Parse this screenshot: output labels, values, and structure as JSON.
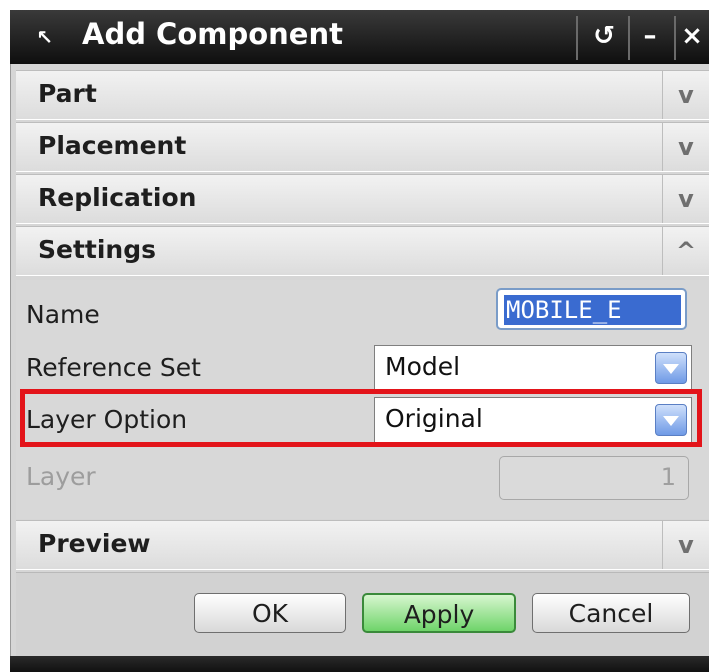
{
  "window": {
    "title": "Add Component"
  },
  "groups": [
    {
      "label": "Part",
      "chevron": "v"
    },
    {
      "label": "Placement",
      "chevron": "v"
    },
    {
      "label": "Replication",
      "chevron": "v"
    },
    {
      "label": "Settings",
      "chevron": "^"
    }
  ],
  "settings": {
    "name_label": "Name",
    "name_value": "MOBILE_E",
    "reference_set_label": "Reference Set",
    "reference_set_value": "Model",
    "layer_option_label": "Layer Option",
    "layer_option_value": "Original",
    "layer_label": "Layer",
    "layer_value": "1"
  },
  "preview": {
    "label": "Preview",
    "chevron": "v"
  },
  "buttons": {
    "ok": "OK",
    "apply": "Apply",
    "cancel": "Cancel"
  },
  "colors": {
    "highlight": "#e3141a",
    "apply_green": "#6fd46a",
    "selection_blue": "#3a6bd0"
  }
}
